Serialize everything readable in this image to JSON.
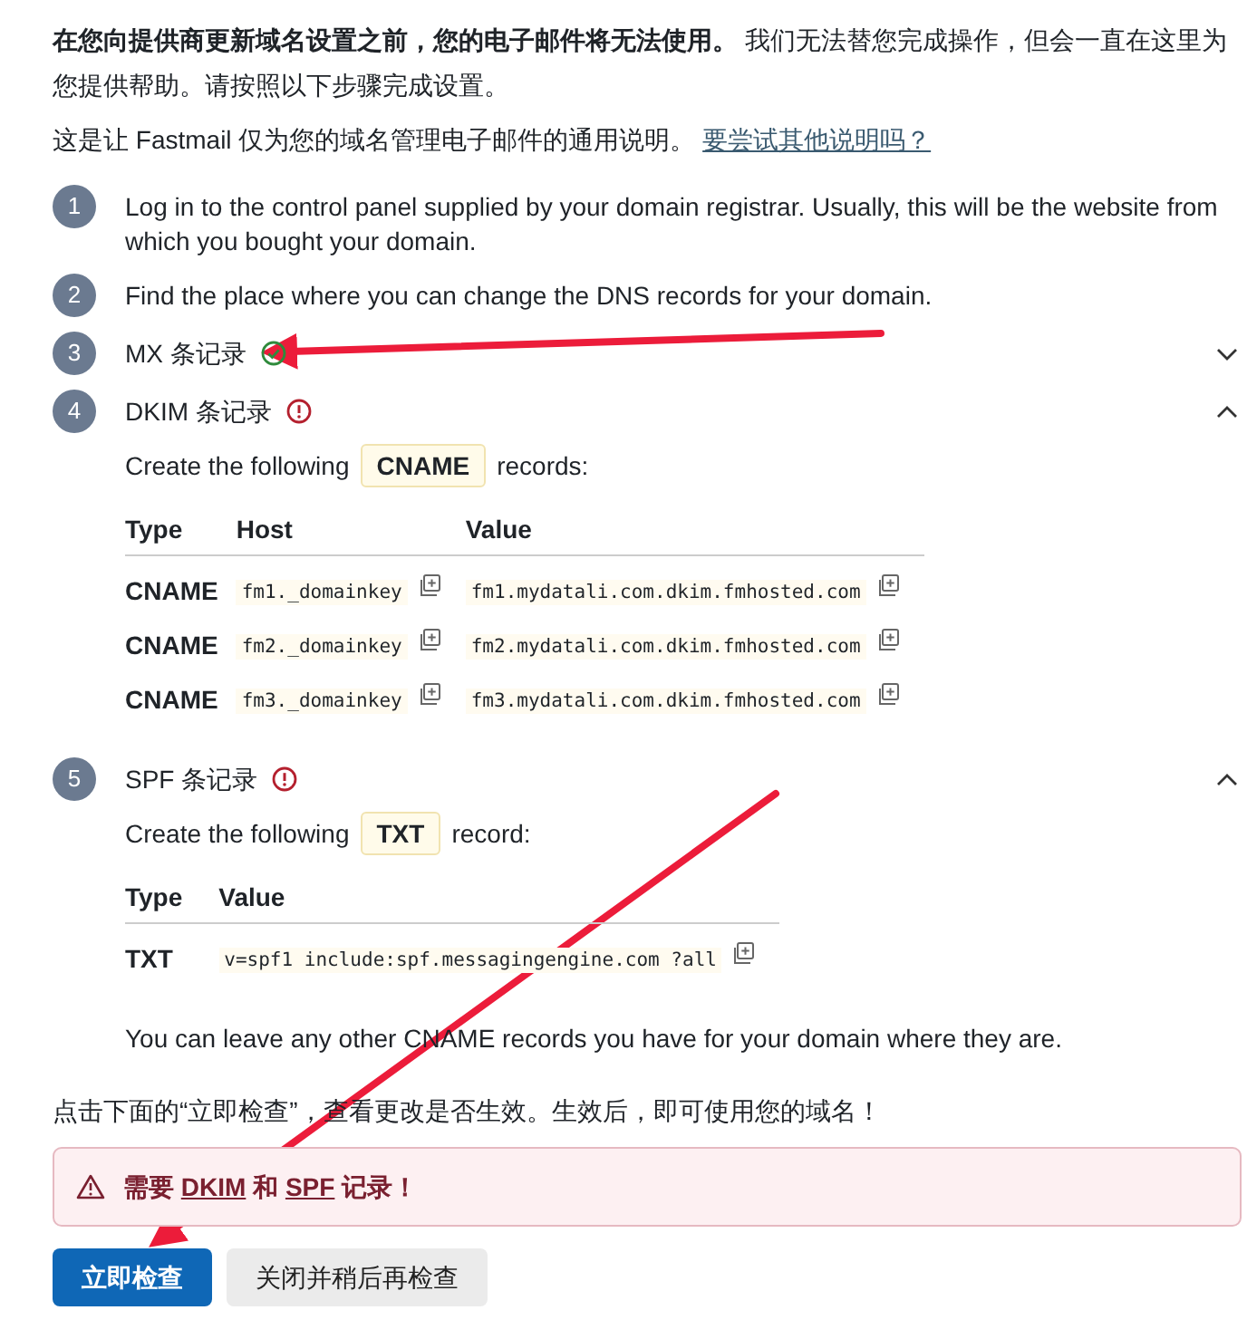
{
  "intro": "**在您向提供商更新域名设置之前，您的电子邮件将无法使用。** 我们无法替您完成操作，但会一直在这里为您提供帮助。请按照以下步骤完成设置。",
  "note": {
    "text": "这是让 Fastmail 仅为您的域名管理电子邮件的通用说明。",
    "link": "要尝试其他说明吗？"
  },
  "steps": [
    {
      "number": "1",
      "kind": "text",
      "text": "Log in to the control panel supplied by your domain registrar. Usually, this will be the website from which you bought your domain."
    },
    {
      "number": "2",
      "kind": "text",
      "text": "Find the place where you can change the DNS records for your domain."
    },
    {
      "number": "3",
      "kind": "record",
      "title": "MX 条记录",
      "verified": true,
      "expanded": false
    },
    {
      "number": "4",
      "kind": "record",
      "title": "DKIM 条记录",
      "verified": false,
      "expanded": true,
      "instruction": {
        "before": "Create the following",
        "badge": "CNAME",
        "after": "records:"
      },
      "columns": [
        "Type",
        "Host",
        "Value"
      ],
      "rows": [
        {
          "type": "CNAME",
          "host": "fm1._domainkey",
          "value": "fm1.mydatali.com.dkim.fmhosted.com"
        },
        {
          "type": "CNAME",
          "host": "fm2._domainkey",
          "value": "fm2.mydatali.com.dkim.fmhosted.com"
        },
        {
          "type": "CNAME",
          "host": "fm3._domainkey",
          "value": "fm3.mydatali.com.dkim.fmhosted.com"
        }
      ]
    },
    {
      "number": "5",
      "kind": "record",
      "title": "SPF 条记录",
      "verified": false,
      "expanded": true,
      "instruction": {
        "before": "Create the following",
        "badge": "TXT",
        "after": "record:"
      },
      "columns": [
        "Type",
        "Value"
      ],
      "rows": [
        {
          "type": "TXT",
          "value": "v=spf1 include:spf.messagingengine.com ?all"
        }
      ],
      "footnote": "You can leave any other CNAME records you have for your domain where they are."
    }
  ],
  "check_hint": "点击下面的“立即检查”，查看更改是否生效。生效后，即可使用您的域名！",
  "alert": {
    "parts": [
      {
        "kind": "text",
        "text": "需要 "
      },
      {
        "kind": "link",
        "text": "DKIM"
      },
      {
        "kind": "text",
        "text": " 和 "
      },
      {
        "kind": "link",
        "text": "SPF"
      },
      {
        "kind": "text",
        "text": " 记录！"
      }
    ]
  },
  "buttons": [
    {
      "label": "立即检查",
      "primary": true
    },
    {
      "label": "关闭并稍后再检查",
      "primary": false
    }
  ]
}
